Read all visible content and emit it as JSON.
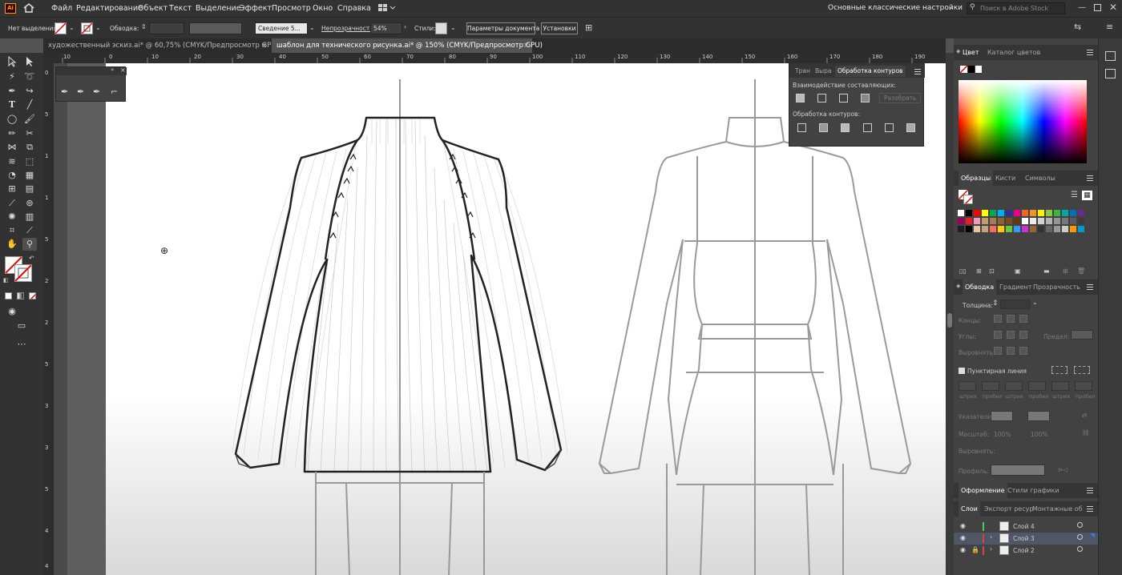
{
  "app": {
    "logo": "Ai"
  },
  "menu": [
    "Файл",
    "Редактирование",
    "Объект",
    "Текст",
    "Выделение",
    "Эффект",
    "Просмотр",
    "Окно",
    "Справка"
  ],
  "workspace": "Основные классические настройки",
  "search": {
    "placeholder": "Поиск в Adobe Stock"
  },
  "control": {
    "no_selection": "Нет выделения",
    "stroke_label": "Обводка:",
    "brush": "Сведение 5...",
    "opacity_label": "Непрозрачность:",
    "opacity_value": "54%",
    "styles_label": "Стили:",
    "doc_setup": "Параметры документа",
    "prefs": "Установки"
  },
  "tabs": [
    {
      "label": "художественный эскиз.ai* @ 60,75% (CMYK/Предпросмотр GPU)",
      "close": "×"
    },
    {
      "label": "шаблон для технического рисунка.ai* @ 150% (CMYK/Предпросмотр GPU)",
      "close": "×"
    }
  ],
  "ruler_top": [
    "10",
    "0",
    "10",
    "20",
    "30",
    "40",
    "50",
    "60",
    "70",
    "80",
    "90",
    "100",
    "110",
    "120",
    "130",
    "140",
    "150",
    "160",
    "170",
    "180",
    "190"
  ],
  "ruler_left": [
    "0",
    "5",
    "1",
    "1",
    "5",
    "2",
    "2",
    "5",
    "3",
    "3",
    "5",
    "4",
    "4"
  ],
  "pathfinder": {
    "tabs": [
      "Тран",
      "Выра",
      "Обработка контуров"
    ],
    "shape_modes": "Взаимодействие составляющих:",
    "expand": "Разобрать",
    "pathfinders": "Обработка контуров:"
  },
  "color": {
    "tabs": [
      "Цвет",
      "Каталог цветов"
    ]
  },
  "swatches": {
    "tabs": [
      "Образцы",
      "Кисти",
      "Символы"
    ],
    "colors": [
      "#ffffff",
      "#000000",
      "#ff0000",
      "#ffff00",
      "#00a651",
      "#00aeef",
      "#2e3192",
      "#ec008c",
      "#f26522",
      "#f7941d",
      "#fff200",
      "#8dc63f",
      "#39b54a",
      "#00a99d",
      "#0072bc",
      "#662d91",
      "#9e005d",
      "#ed1c24",
      "#f49ac1",
      "#c69c6d",
      "#a67c52",
      "#8c6239",
      "#754c24",
      "#603913",
      "#ffffff",
      "#ebebeb",
      "#d1d1d1",
      "#b3b3b3",
      "#959595",
      "#777777",
      "#5a5a5a",
      "#3c3c3c",
      "#1e1e1e",
      "#000000",
      "#e4c59e",
      "#c4a484",
      "#ff6666",
      "#ffcc00",
      "#66cc33",
      "#3399ff",
      "#cc33cc",
      "#996633",
      "#333333",
      "#666666",
      "#999999",
      "#cccccc",
      "#ff9900",
      "#0099cc"
    ]
  },
  "stroke": {
    "tabs": [
      "Обводка",
      "Градиент",
      "Прозрачность"
    ],
    "weight": "Толщина:",
    "caps": "Концы:",
    "corners": "Углы:",
    "limit": "Предел:",
    "align": "Выровнять:",
    "dashed": "Пунктирная линия",
    "dash_labels": [
      "штрих",
      "пробел",
      "штрих",
      "пробел",
      "штрих",
      "пробел"
    ],
    "arrows": "Указатели:",
    "scale": "Масштаб:",
    "scale_vals": [
      "100%",
      "100%"
    ],
    "align2": "Выровнять:",
    "profile": "Профиль:"
  },
  "appearance": {
    "tabs": [
      "Оформление",
      "Стили графики"
    ]
  },
  "layers": {
    "tabs": [
      "Слои",
      "Экспорт ресур",
      "Монтажные об"
    ],
    "items": [
      {
        "name": "Слой 4",
        "color": "#4ecb4e"
      },
      {
        "name": "Слой 3",
        "color": "#e04040"
      },
      {
        "name": "Слой 2",
        "color": "#e04040"
      }
    ]
  }
}
